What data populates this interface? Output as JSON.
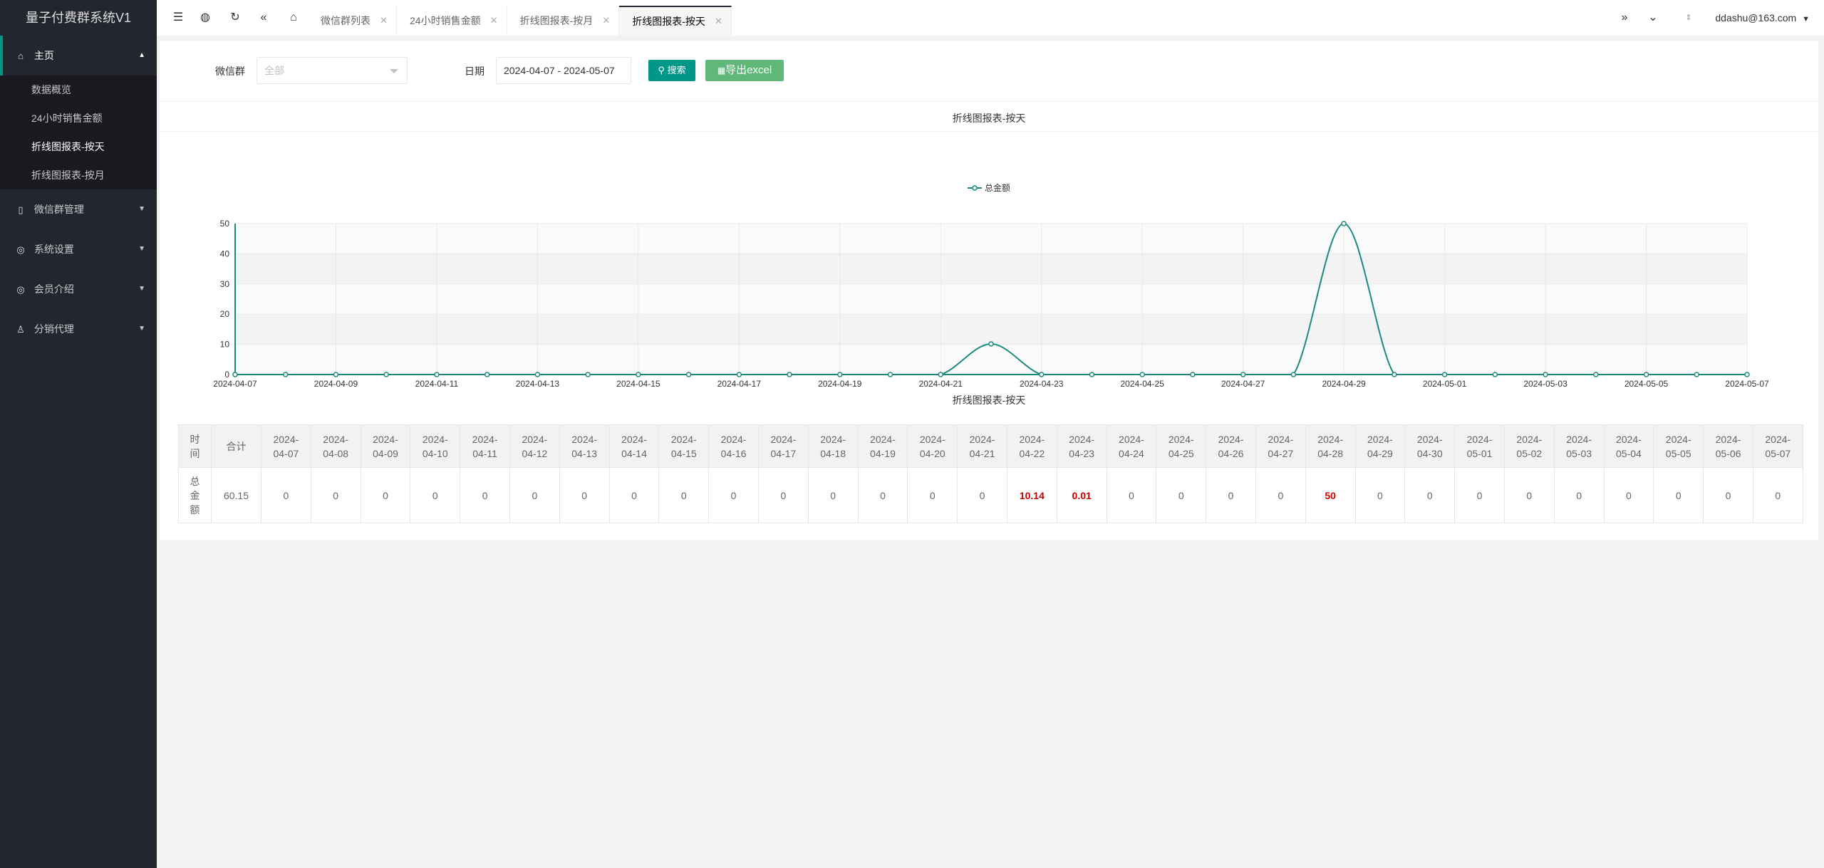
{
  "app": {
    "title": "量子付费群系统V1"
  },
  "sidebar": {
    "home": {
      "label": "主页"
    },
    "sub_items": [
      {
        "label": "数据概览"
      },
      {
        "label": "24小时销售金额"
      },
      {
        "label": "折线图报表-按天"
      },
      {
        "label": "折线图报表-按月"
      }
    ],
    "groups": [
      {
        "label": "微信群管理"
      },
      {
        "label": "系统设置"
      },
      {
        "label": "会员介绍"
      },
      {
        "label": "分销代理"
      }
    ]
  },
  "tabs": [
    {
      "label": "微信群列表"
    },
    {
      "label": "24小时销售金额"
    },
    {
      "label": "折线图报表-按月"
    },
    {
      "label": "折线图报表-按天"
    }
  ],
  "header": {
    "user": "ddashu@163.com"
  },
  "filter": {
    "group_label": "微信群",
    "group_placeholder": "全部",
    "date_label": "日期",
    "date_value": "2024-04-07 - 2024-05-07",
    "search_label": "搜索",
    "export_label": "导出excel"
  },
  "chart_title": "折线图报表-按天",
  "table_title": "折线图报表-按天",
  "chart_data": {
    "type": "line",
    "title": "折线图报表-按天",
    "legend_position": "top-center",
    "series": [
      {
        "name": "总金额",
        "color": "#1a8a7f",
        "values": [
          0,
          0,
          0,
          0,
          0,
          0,
          0,
          0,
          0,
          0,
          0,
          0,
          0,
          0,
          0,
          10.14,
          0.01,
          0,
          0,
          0,
          0,
          0,
          50,
          0,
          0,
          0,
          0,
          0,
          0,
          0,
          0
        ]
      }
    ],
    "x": [
      "2024-04-07",
      "2024-04-08",
      "2024-04-09",
      "2024-04-10",
      "2024-04-11",
      "2024-04-12",
      "2024-04-13",
      "2024-04-14",
      "2024-04-15",
      "2024-04-16",
      "2024-04-17",
      "2024-04-18",
      "2024-04-19",
      "2024-04-20",
      "2024-04-21",
      "2024-04-22",
      "2024-04-23",
      "2024-04-24",
      "2024-04-25",
      "2024-04-26",
      "2024-04-27",
      "2024-04-28",
      "2024-04-29",
      "2024-04-30",
      "2024-05-01",
      "2024-05-02",
      "2024-05-03",
      "2024-05-04",
      "2024-05-05",
      "2024-05-06",
      "2024-05-07"
    ],
    "x_tick_labels": [
      "2024-04-07",
      "2024-04-09",
      "2024-04-11",
      "2024-04-13",
      "2024-04-15",
      "2024-04-17",
      "2024-04-19",
      "2024-04-21",
      "2024-04-23",
      "2024-04-25",
      "2024-04-27",
      "2024-04-29",
      "2024-05-01",
      "2024-05-03",
      "2024-05-05",
      "2024-05-07"
    ],
    "y_ticks": [
      "0",
      "10",
      "20",
      "30",
      "40",
      "50"
    ],
    "ylim": [
      0,
      50
    ],
    "grid": true,
    "smooth": true
  },
  "table": {
    "header_label": "时间",
    "total_header": "合计",
    "row_label": "总金额",
    "total_value": "60.15",
    "dates": [
      "2024-04-07",
      "2024-04-08",
      "2024-04-09",
      "2024-04-10",
      "2024-04-11",
      "2024-04-12",
      "2024-04-13",
      "2024-04-14",
      "2024-04-15",
      "2024-04-16",
      "2024-04-17",
      "2024-04-18",
      "2024-04-19",
      "2024-04-20",
      "2024-04-21",
      "2024-04-22",
      "2024-04-23",
      "2024-04-24",
      "2024-04-25",
      "2024-04-26",
      "2024-04-27",
      "2024-04-28",
      "2024-04-29",
      "2024-04-30",
      "2024-05-01",
      "2024-05-02",
      "2024-05-03",
      "2024-05-04",
      "2024-05-05",
      "2024-05-06",
      "2024-05-07"
    ],
    "values": [
      "0",
      "0",
      "0",
      "0",
      "0",
      "0",
      "0",
      "0",
      "0",
      "0",
      "0",
      "0",
      "0",
      "0",
      "0",
      "10.14",
      "0.01",
      "0",
      "0",
      "0",
      "0",
      "50",
      "0",
      "0",
      "0",
      "0",
      "0",
      "0",
      "0",
      "0",
      "0"
    ],
    "highlight_color": "#cc0000"
  }
}
